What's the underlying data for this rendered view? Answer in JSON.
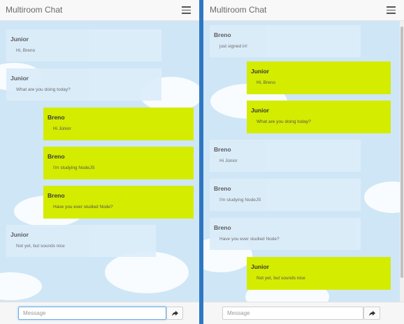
{
  "left": {
    "title": "Multiroom Chat",
    "input_placeholder": "Message",
    "messages": [
      {
        "author": "Junior",
        "text": "Hi, Breno",
        "mine": false
      },
      {
        "author": "Junior",
        "text": "What are you doing today?",
        "mine": false
      },
      {
        "author": "Breno",
        "text": "Hi Júnior",
        "mine": true
      },
      {
        "author": "Breno",
        "text": "I'm studying NodeJS",
        "mine": true
      },
      {
        "author": "Breno",
        "text": "Have you ever studied Node?",
        "mine": true
      },
      {
        "author": "Junior",
        "text": "Not yet, but sounds nice",
        "mine": false
      }
    ]
  },
  "right": {
    "title": "Multiroom Chat",
    "input_placeholder": "Message",
    "messages": [
      {
        "author": "Breno",
        "text": "just signed in!",
        "mine": false
      },
      {
        "author": "Junior",
        "text": "Hi, Breno",
        "mine": true
      },
      {
        "author": "Junior",
        "text": "What are you doing today?",
        "mine": true
      },
      {
        "author": "Breno",
        "text": "Hi Júnior",
        "mine": false
      },
      {
        "author": "Breno",
        "text": "I'm studying NodeJS",
        "mine": false
      },
      {
        "author": "Breno",
        "text": "Have you ever studied Node?",
        "mine": false
      },
      {
        "author": "Junior",
        "text": "Not yet, but sounds nice",
        "mine": true
      }
    ]
  },
  "colors": {
    "own_message": "#d4ec00",
    "other_message": "#dcedfa",
    "sky": "#cfe6f6",
    "divider": "#2f77c4"
  },
  "icons": {
    "menu": "hamburger-icon",
    "send": "share-arrow-icon"
  }
}
